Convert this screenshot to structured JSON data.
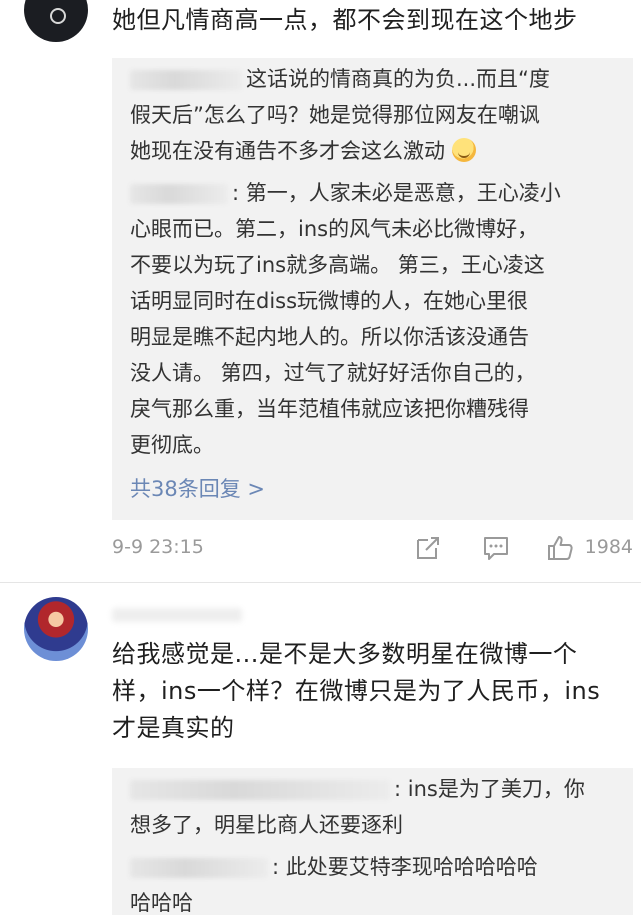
{
  "first_comment": {
    "text": "她但凡情商高一点，都不会到现在这个地步",
    "replies": [
      {
        "line1": "这话说的情商真的为负...而且“度",
        "line2": "假天后”怎么了吗？她是觉得那位网友在嘲讽",
        "line3": "她现在没有通告不多才会这么激动"
      },
      {
        "line1": ": 第一，人家未必是恶意，王心凌小",
        "line2": "心眼而已。第二，ins的风气未必比微博好，",
        "line3": "不要以为玩了ins就多高端。 第三，王心凌这",
        "line4": "话明显同时在diss玩微博的人，在她心里很",
        "line5": "明显是瞧不起内地人的。所以你活该没通告",
        "line6": "没人请。 第四，过气了就好好活你自己的，",
        "line7": "戾气那么重，当年范植伟就应该把你糟残得",
        "line8": "更彻底。"
      }
    ],
    "more_replies": "共38条回复 >",
    "time": "9-9 23:15",
    "likes": "1984",
    "icons": {
      "share": "share-icon",
      "comment": "comment-icon",
      "like": "thumbs-up-icon"
    }
  },
  "second_comment": {
    "line1": "给我感觉是...是不是大多数明星在微博一个",
    "line2": "样，ins一个样？在微博只是为了人民币，ins",
    "line3": "才是真实的",
    "replies": [
      {
        "line1": ": ins是为了美刀，你",
        "line2": "想多了，明星比商人还要逐利"
      },
      {
        "line1": ": 此处要艾特李现哈哈哈哈哈",
        "line2": "哈哈哈"
      }
    ]
  },
  "colors": {
    "link": "#6b87b5",
    "reply_bg": "#f2f2f2",
    "meta": "#9a9a9a"
  }
}
